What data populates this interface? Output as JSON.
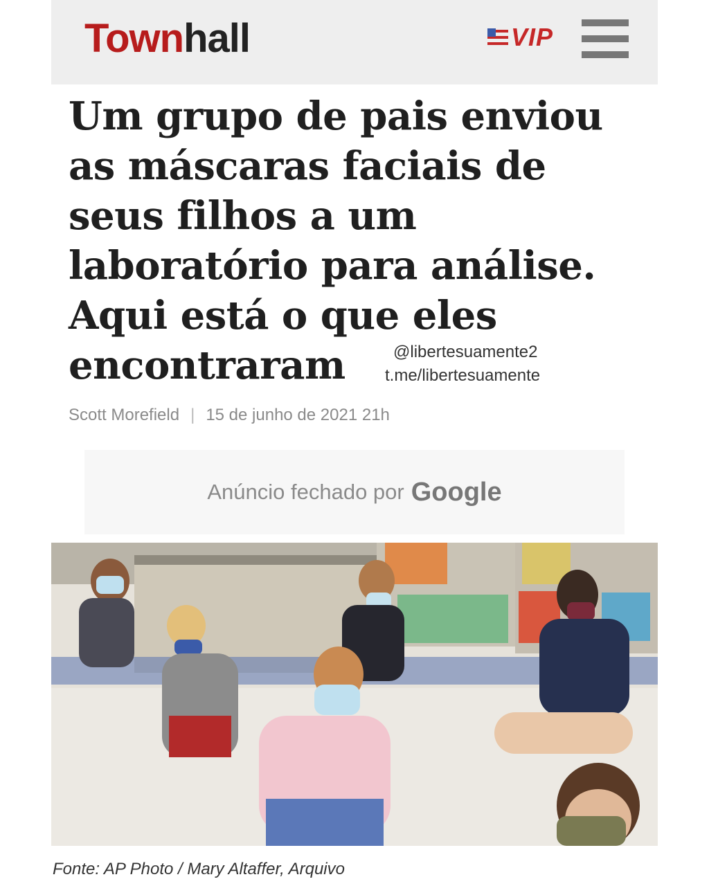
{
  "header": {
    "logo_part1": "Town",
    "logo_part2": "hall",
    "vip_label": "VIP",
    "menu_icon": "hamburger-menu-icon",
    "flag_icon": "us-flag-icon",
    "brand_color": "#b71c1c",
    "vip_color": "#c62828"
  },
  "article": {
    "headline_lines": [
      "Um grupo de pais enviou",
      "as máscaras faciais de",
      "seus filhos a um",
      "laboratório para análise.",
      "Aqui está o que eles",
      "encontraram"
    ],
    "author": "Scott Morefield",
    "separator": "|",
    "date": "15 de junho de 2021 21h"
  },
  "watermark": {
    "line1": "@libertesuamente2",
    "line2": "t.me/libertesuamente"
  },
  "ad": {
    "text": "Anúncio fechado por",
    "brand": "Google"
  },
  "photo": {
    "caption": "Fonte: AP Photo / Mary Altaffer, Arquivo"
  }
}
